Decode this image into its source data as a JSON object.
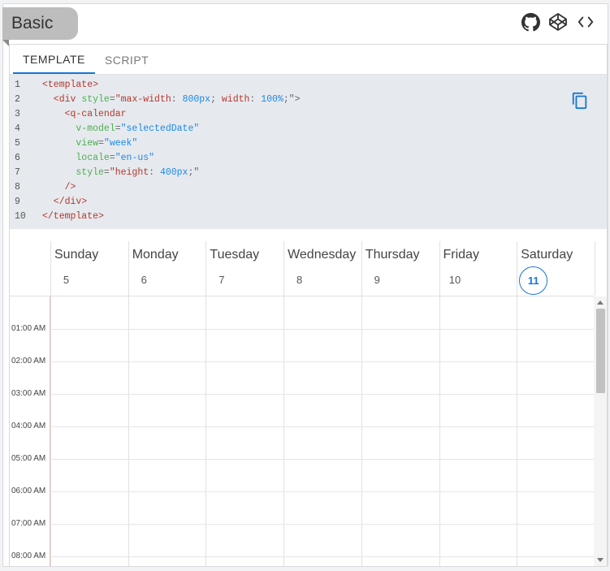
{
  "example": {
    "title": "Basic"
  },
  "header_icons": [
    "github-icon",
    "codepen-icon",
    "code-icon"
  ],
  "tabs": [
    {
      "label": "TEMPLATE"
    },
    {
      "label": "SCRIPT"
    }
  ],
  "code": {
    "lines": [
      {
        "n": "1",
        "parts": [
          [
            "tag2",
            "<template>"
          ]
        ]
      },
      {
        "n": "2",
        "parts": [
          [
            "tag2",
            "  <div "
          ],
          [
            "attr",
            "style"
          ],
          [
            "punc",
            "="
          ],
          [
            "tag2",
            "\"max-width"
          ],
          [
            "punc",
            ": "
          ],
          [
            "val",
            "800px"
          ],
          [
            "punc",
            "; "
          ],
          [
            "tag2",
            "width"
          ],
          [
            "punc",
            ": "
          ],
          [
            "val",
            "100%"
          ],
          [
            "punc",
            ";\">"
          ]
        ]
      },
      {
        "n": "3",
        "parts": [
          [
            "tag2",
            "    <q-calendar"
          ]
        ]
      },
      {
        "n": "4",
        "parts": [
          [
            "attr",
            "      v-model"
          ],
          [
            "punc",
            "="
          ],
          [
            "val",
            "\"selectedDate\""
          ]
        ]
      },
      {
        "n": "5",
        "parts": [
          [
            "attr",
            "      view"
          ],
          [
            "punc",
            "="
          ],
          [
            "val",
            "\"week\""
          ]
        ]
      },
      {
        "n": "6",
        "parts": [
          [
            "attr",
            "      locale"
          ],
          [
            "punc",
            "="
          ],
          [
            "val",
            "\"en-us\""
          ]
        ]
      },
      {
        "n": "7",
        "parts": [
          [
            "attr",
            "      style"
          ],
          [
            "punc",
            "="
          ],
          [
            "tag2",
            "\"height"
          ],
          [
            "punc",
            ": "
          ],
          [
            "val",
            "400px"
          ],
          [
            "punc",
            ";\""
          ]
        ]
      },
      {
        "n": "8",
        "parts": [
          [
            "tag2",
            "    />"
          ]
        ]
      },
      {
        "n": "9",
        "parts": [
          [
            "tag2",
            "  </div>"
          ]
        ]
      },
      {
        "n": "10",
        "parts": [
          [
            "tag2",
            "</template>"
          ]
        ]
      }
    ]
  },
  "calendar": {
    "days": [
      {
        "name": "Sunday",
        "num": "5",
        "today": false
      },
      {
        "name": "Monday",
        "num": "6",
        "today": false
      },
      {
        "name": "Tuesday",
        "num": "7",
        "today": false
      },
      {
        "name": "Wednesday",
        "num": "8",
        "today": false
      },
      {
        "name": "Thursday",
        "num": "9",
        "today": false
      },
      {
        "name": "Friday",
        "num": "10",
        "today": false
      },
      {
        "name": "Saturday",
        "num": "11",
        "today": true
      }
    ],
    "hours": [
      "01:00 AM",
      "02:00 AM",
      "03:00 AM",
      "04:00 AM",
      "05:00 AM",
      "06:00 AM",
      "07:00 AM",
      "08:00 AM"
    ],
    "accent": "#1976d2"
  }
}
